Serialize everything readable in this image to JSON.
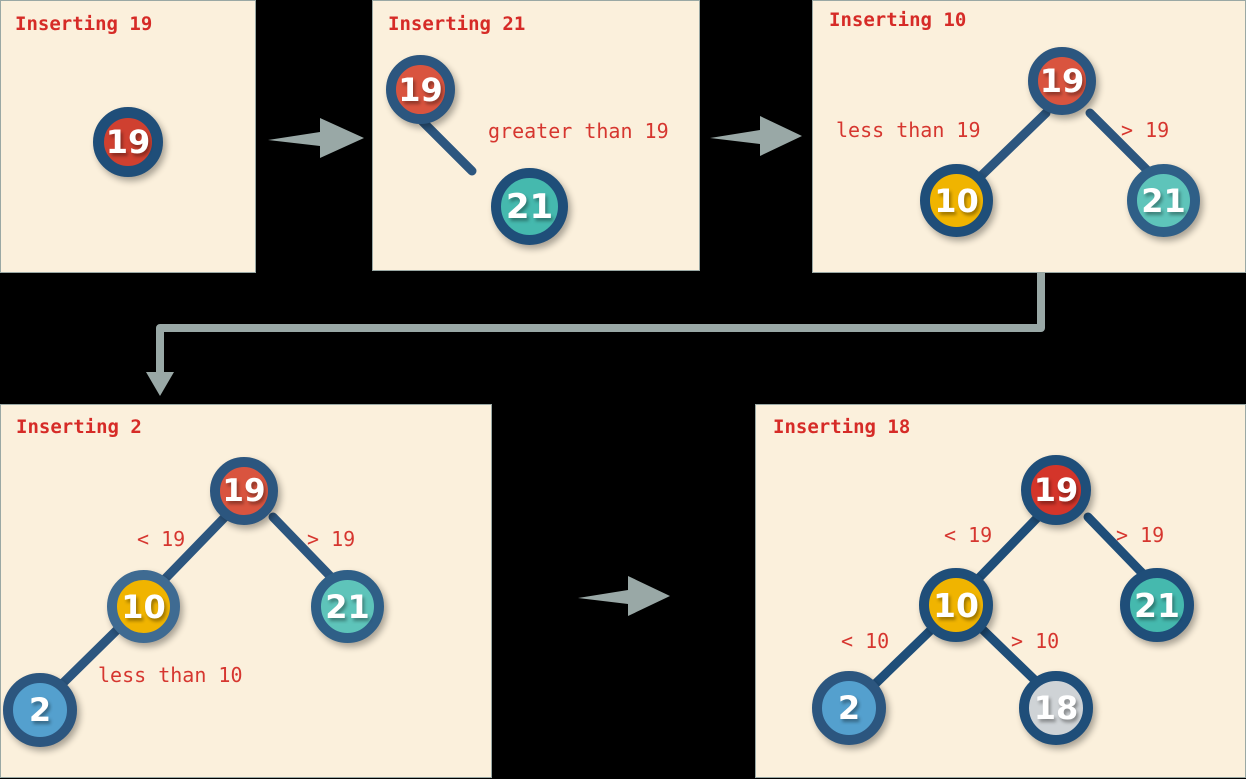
{
  "colors": {
    "panel_bg": "#fbf0dc",
    "panel_border": "#9aa8a4",
    "page_bg": "#000000",
    "title_red": "#d62b27",
    "label_red": "#d6362f",
    "node_ring": "#1f4e79",
    "node_red": "#cf4030",
    "node_teal": "#45b9ae",
    "node_yellow": "#f0b400",
    "node_blue": "#54a0ce",
    "node_gray": "#cfd3d6",
    "edge_line": "#2c567f",
    "arrow_gray": "#99a8a6"
  },
  "panels": [
    {
      "id": "panel-inserting-19",
      "title": "Inserting 19",
      "nodes": [
        {
          "label": "19",
          "color": "node_red"
        }
      ],
      "edge_labels": []
    },
    {
      "id": "panel-inserting-21",
      "title": "Inserting 21",
      "nodes": [
        {
          "label": "19",
          "color": "node_red"
        },
        {
          "label": "21",
          "color": "node_teal"
        }
      ],
      "edge_labels": [
        "greater than 19"
      ]
    },
    {
      "id": "panel-inserting-10",
      "title": "Inserting 10",
      "nodes": [
        {
          "label": "19",
          "color": "node_red"
        },
        {
          "label": "10",
          "color": "node_yellow"
        },
        {
          "label": "21",
          "color": "node_teal"
        }
      ],
      "edge_labels": [
        "less than 19",
        "> 19"
      ]
    },
    {
      "id": "panel-inserting-2",
      "title": "Inserting 2",
      "nodes": [
        {
          "label": "19",
          "color": "node_red"
        },
        {
          "label": "10",
          "color": "node_yellow"
        },
        {
          "label": "21",
          "color": "node_teal"
        },
        {
          "label": "2",
          "color": "node_blue"
        }
      ],
      "edge_labels": [
        "< 19",
        "> 19",
        "less than 10"
      ]
    },
    {
      "id": "panel-inserting-18",
      "title": "Inserting 18",
      "nodes": [
        {
          "label": "19",
          "color": "node_red"
        },
        {
          "label": "10",
          "color": "node_yellow"
        },
        {
          "label": "21",
          "color": "node_teal"
        },
        {
          "label": "2",
          "color": "node_blue"
        },
        {
          "label": "18",
          "color": "node_gray"
        }
      ],
      "edge_labels": [
        "< 19",
        "> 19",
        "< 10",
        "> 10"
      ]
    }
  ],
  "panel1": {
    "title": "Inserting 19",
    "node_19": "19"
  },
  "panel2": {
    "title": "Inserting 21",
    "node_19": "19",
    "node_21": "21",
    "label_right": "greater than 19"
  },
  "panel3": {
    "title": "Inserting 10",
    "node_19": "19",
    "node_10": "10",
    "node_21": "21",
    "label_left": "less than 19",
    "label_right": "> 19"
  },
  "panel4": {
    "title": "Inserting 2",
    "node_19": "19",
    "node_10": "10",
    "node_21": "21",
    "node_2": "2",
    "label_left": "< 19",
    "label_right": "> 19",
    "label_lower_left": "less than 10"
  },
  "panel5": {
    "title": "Inserting 18",
    "node_19": "19",
    "node_10": "10",
    "node_21": "21",
    "node_2": "2",
    "node_18": "18",
    "label_left": "< 19",
    "label_right": "> 19",
    "label_lower_left": "< 10",
    "label_lower_right": "> 10"
  },
  "arrows": {
    "arrow_1_2": "arrow-right-icon",
    "arrow_2_3": "arrow-right-icon",
    "arrow_3_4": "elbow-arrow-down-icon",
    "arrow_4_5": "arrow-right-icon"
  }
}
